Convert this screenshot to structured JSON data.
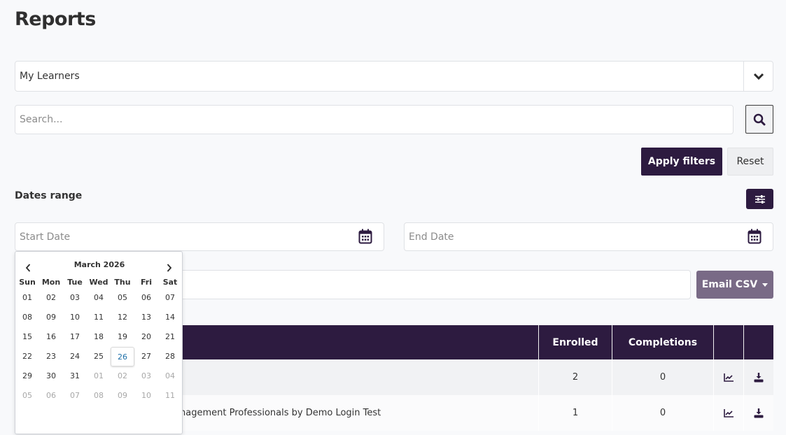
{
  "page": {
    "title": "Reports"
  },
  "report_select": {
    "value": "My Learners"
  },
  "search": {
    "placeholder": "Search..."
  },
  "filters": {
    "apply_label": "Apply filters",
    "reset_label": "Reset"
  },
  "dates": {
    "label": "Dates range",
    "start_placeholder": "Start Date",
    "end_placeholder": "End Date"
  },
  "email": {
    "label": "Email CSV"
  },
  "table": {
    "headers": {
      "enrolled": "Enrolled",
      "completions": "Completions"
    },
    "rows": [
      {
        "name": "",
        "enrolled": "2",
        "completions": "0"
      },
      {
        "name": "nagement Professionals by Demo Login Test",
        "enrolled": "1",
        "completions": "0"
      }
    ]
  },
  "calendar": {
    "month_label": "March 2026",
    "weekdays": [
      "Sun",
      "Mon",
      "Tue",
      "Wed",
      "Thu",
      "Fri",
      "Sat"
    ],
    "weeks": [
      [
        "01",
        "02",
        "03",
        "04",
        "05",
        "06",
        "07"
      ],
      [
        "08",
        "09",
        "10",
        "11",
        "12",
        "13",
        "14"
      ],
      [
        "15",
        "16",
        "17",
        "18",
        "19",
        "20",
        "21"
      ],
      [
        "22",
        "23",
        "24",
        "25",
        "26",
        "27",
        "28"
      ],
      [
        "29",
        "30",
        "31",
        "01",
        "02",
        "03",
        "04"
      ],
      [
        "05",
        "06",
        "07",
        "08",
        "09",
        "10",
        "11"
      ]
    ],
    "today": "26"
  },
  "colors": {
    "primary": "#2d1b40",
    "email_button": "#796a86",
    "today": "#1e6fa8"
  },
  "icons": {
    "select_toggle": "chevron-down-icon",
    "search": "search-icon",
    "filter": "sliders-icon",
    "date": "calendar-icon",
    "row_stats": "chart-line-icon",
    "row_download": "download-icon"
  }
}
